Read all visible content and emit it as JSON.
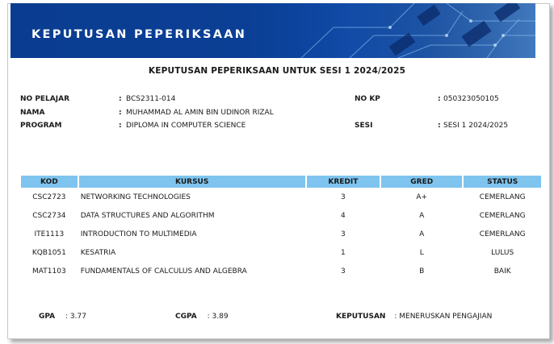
{
  "banner": {
    "title": "KEPUTUSAN PEPERIKSAAN"
  },
  "heading": "KEPUTUSAN PEPERIKSAAN UNTUK SESI 1 2024/2025",
  "student": {
    "no_pelajar": {
      "label": "NO PELAJAR",
      "value": "BCS2311-014"
    },
    "nama": {
      "label": "NAMA",
      "value": "MUHAMMAD AL AMIN BIN UDINOR RIZAL"
    },
    "program": {
      "label": "PROGRAM",
      "value": "DIPLOMA IN COMPUTER SCIENCE"
    },
    "no_kp": {
      "label": "NO KP",
      "value": "050323050105"
    },
    "sesi": {
      "label": "SESI",
      "value": "SESI 1 2024/2025"
    },
    "separator": ":"
  },
  "table": {
    "headers": {
      "kod": "KOD",
      "kursus": "KURSUS",
      "kredit": "KREDIT",
      "gred": "GRED",
      "status": "STATUS"
    },
    "rows": [
      {
        "kod": "CSC2723",
        "kursus": "NETWORKING TECHNOLOGIES",
        "kredit": "3",
        "gred": "A+",
        "status": "CEMERLANG"
      },
      {
        "kod": "CSC2734",
        "kursus": "DATA STRUCTURES AND ALGORITHM",
        "kredit": "4",
        "gred": "A",
        "status": "CEMERLANG"
      },
      {
        "kod": "ITE1113",
        "kursus": "INTRODUCTION TO MULTIMEDIA",
        "kredit": "3",
        "gred": "A",
        "status": "CEMERLANG"
      },
      {
        "kod": "KQB1051",
        "kursus": "KESATRIA",
        "kredit": "1",
        "gred": "L",
        "status": "LULUS"
      },
      {
        "kod": "MAT1103",
        "kursus": "FUNDAMENTALS OF CALCULUS AND ALGEBRA",
        "kredit": "3",
        "gred": "B",
        "status": "BAIK"
      }
    ]
  },
  "summary": {
    "gpa": {
      "label": "GPA",
      "value": "3.77"
    },
    "cgpa": {
      "label": "CGPA",
      "value": "3.89"
    },
    "keputusan": {
      "label": "KEPUTUSAN",
      "value": "MENERUSKAN PENGAJIAN"
    },
    "separator": ":"
  },
  "colors": {
    "banner_blue": "#0b3f95",
    "header_blue": "#7ec4ee"
  }
}
